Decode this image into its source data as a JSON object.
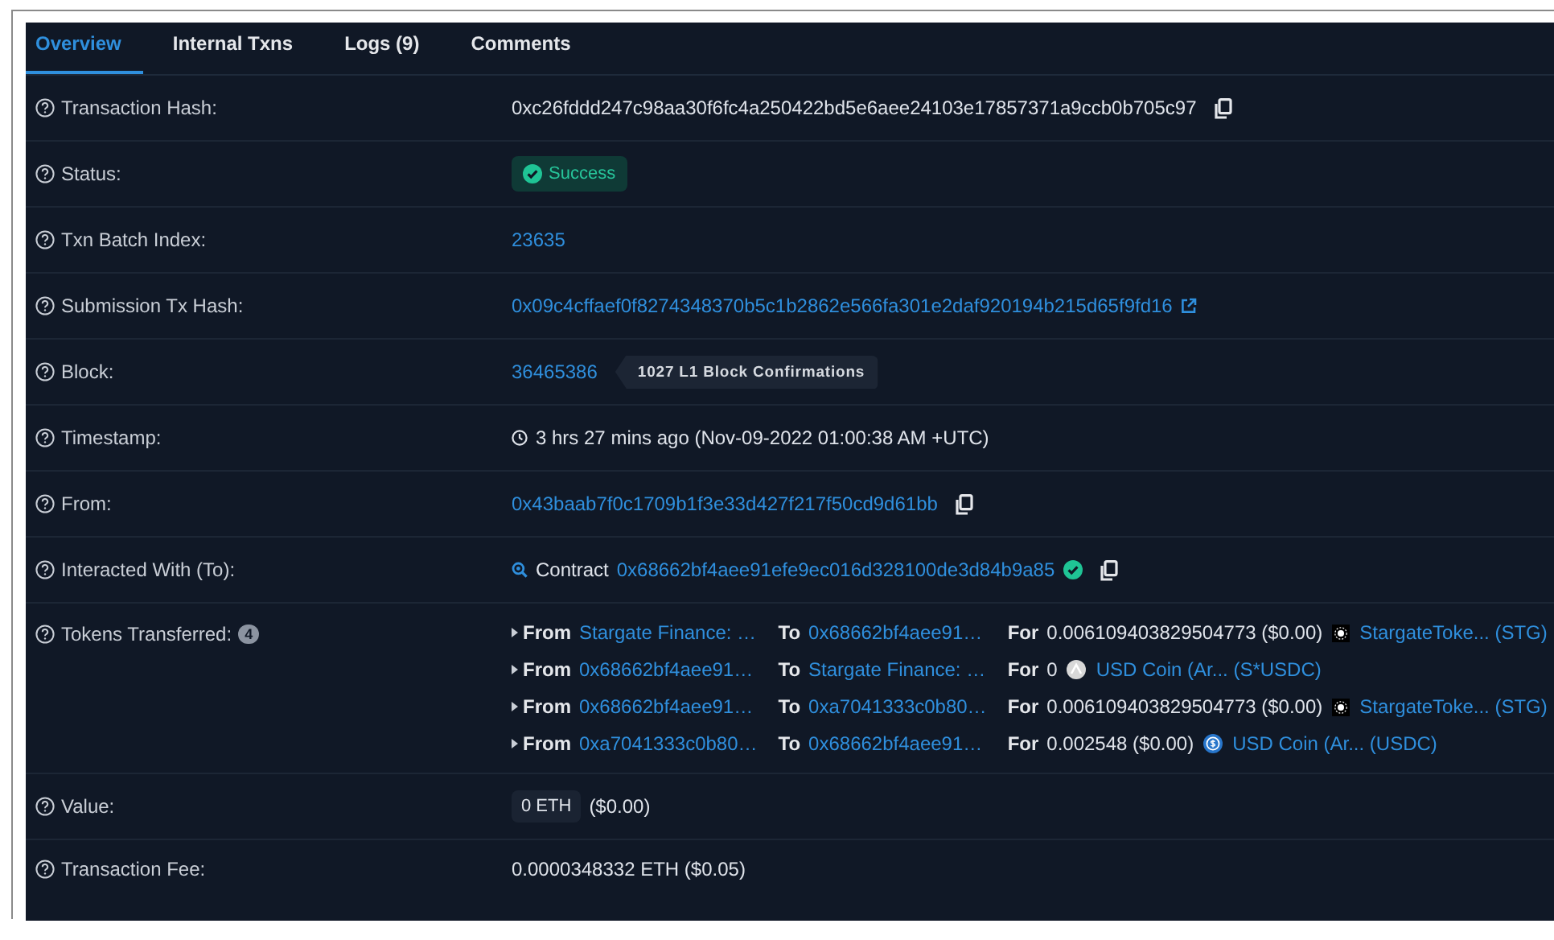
{
  "tabs": [
    {
      "label": "Overview",
      "selected": true
    },
    {
      "label": "Internal Txns",
      "selected": false
    },
    {
      "label": "Logs (9)",
      "selected": false
    },
    {
      "label": "Comments",
      "selected": false
    }
  ],
  "rows": [
    {
      "label": "Transaction Hash:",
      "kind": "hash",
      "value": "0xc26fddd247c98aa30f6fc4a250422bd5e6aee24103e17857371a9ccb0b705c97"
    },
    {
      "label": "Status:",
      "kind": "status",
      "value": "Success"
    },
    {
      "label": "Txn Batch Index:",
      "kind": "link",
      "value": "23635"
    },
    {
      "label": "Submission Tx Hash:",
      "kind": "external",
      "value": "0x09c4cffaef0f8274348370b5c1b2862e566fa301e2daf920194b215d65f9fd16"
    },
    {
      "label": "Block:",
      "kind": "block",
      "value": "36465386",
      "tag": "1027 L1 Block Confirmations"
    },
    {
      "label": "Timestamp:",
      "kind": "time",
      "value": "3 hrs 27 mins ago (Nov-09-2022 01:00:38 AM +UTC)"
    },
    {
      "label": "From:",
      "kind": "address",
      "value": "0x43baab7f0c1709b1f3e33d427f217f50cd9d61bb"
    },
    {
      "label": "Interacted With (To):",
      "kind": "contract",
      "prefix": "Contract",
      "value": "0x68662bf4aee91efe9ec016d328100de3d84b9a85"
    },
    {
      "label": "Tokens Transferred:",
      "kind": "tokens",
      "count": "4",
      "transfers": [
        {
          "from_word": "From",
          "from": "Stargate Finance: …",
          "to_word": "To",
          "to": "0x68662bf4aee91…",
          "for_word": "For",
          "amount": "0.006109403829504773 ($0.00)",
          "kind": "stg",
          "token": "StargateToke... (STG)"
        },
        {
          "from_word": "From",
          "from": "0x68662bf4aee91…",
          "to_word": "To",
          "to": "Stargate Finance: …",
          "for_word": "For",
          "amount": "0",
          "kind": "silver",
          "token": "USD Coin (Ar... (S*USDC)"
        },
        {
          "from_word": "From",
          "from": "0x68662bf4aee91…",
          "to_word": "To",
          "to": "0xa7041333c0b80…",
          "for_word": "For",
          "amount": "0.006109403829504773 ($0.00)",
          "kind": "stg",
          "token": "StargateToke... (STG)"
        },
        {
          "from_word": "From",
          "from": "0xa7041333c0b80…",
          "to_word": "To",
          "to": "0x68662bf4aee91…",
          "for_word": "For",
          "amount": "0.002548 ($0.00)",
          "kind": "usdc",
          "token": "USD Coin (Ar... (USDC)"
        }
      ]
    },
    {
      "label": "Value:",
      "kind": "value",
      "chip": "0 ETH",
      "value": "($0.00)"
    },
    {
      "label": "Transaction Fee:",
      "kind": "text",
      "value": "0.0000348332 ETH ($0.05)"
    }
  ]
}
